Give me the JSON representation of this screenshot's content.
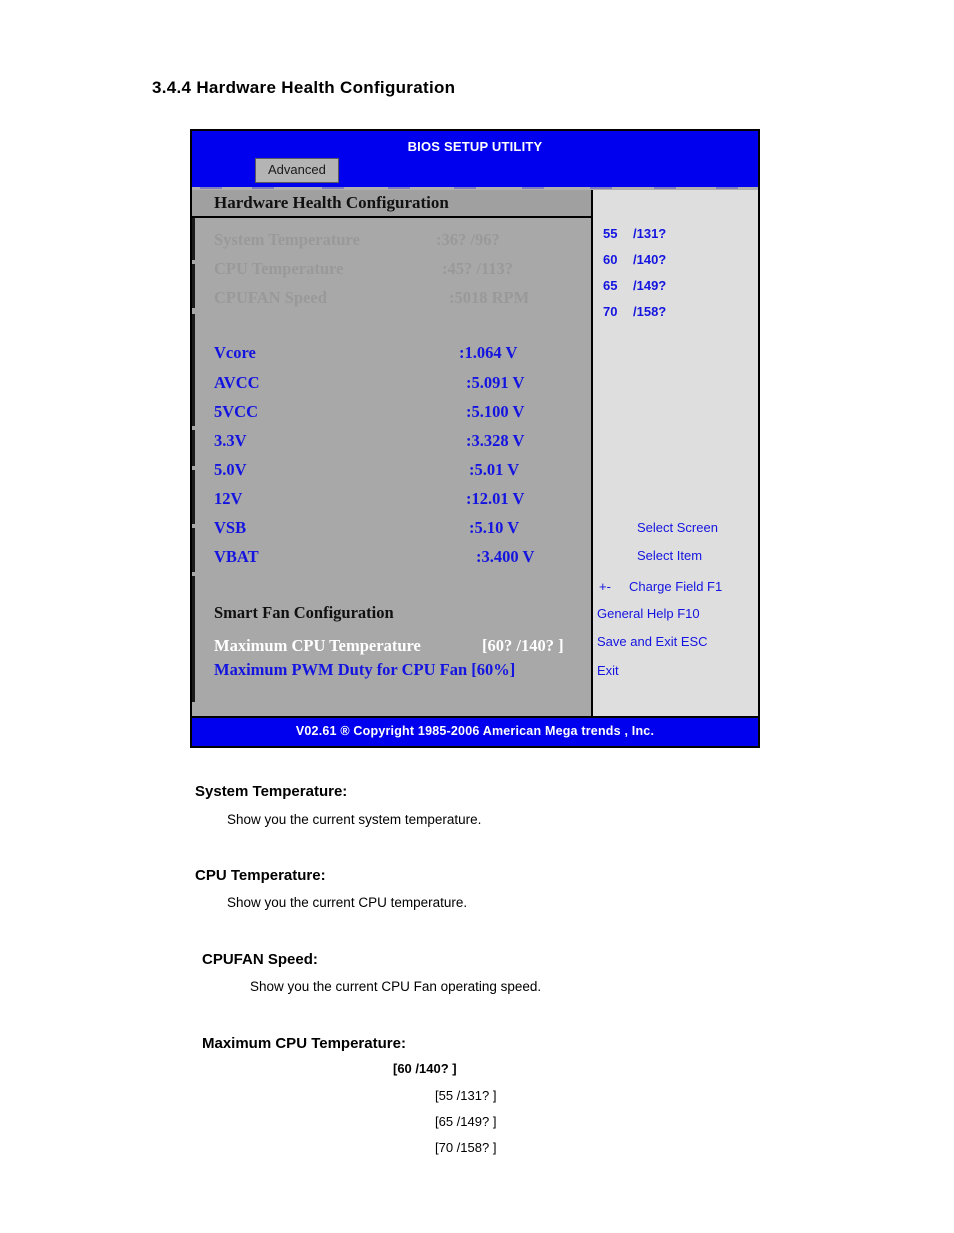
{
  "document": {
    "section_heading": "3.4.4 Hardware Health Configuration"
  },
  "bios": {
    "title": "BIOS SETUP UTILITY",
    "tab": "Advanced",
    "pane_header": "Hardware Health Configuration",
    "footer": "V02.61 ®  Copyright 1985-2006 American Mega trends , Inc.",
    "colors": {
      "title_bar": "#0000ee",
      "main_pane": "#a8a8a8",
      "help_pane": "#dedede",
      "value_blue": "#1414e0",
      "dim_gray": "#999999",
      "highlight_white": "#ffffff"
    },
    "readings": [
      {
        "label": "System Temperature",
        "value": ":36?  /96?",
        "style": "dim"
      },
      {
        "label": "CPU Temperature",
        "value": ":45?  /113?",
        "style": "dim"
      },
      {
        "label": "CPUFAN Speed",
        "value": ":5018 RPM",
        "style": "dim"
      }
    ],
    "voltages": [
      {
        "label": "Vcore",
        "value": ":1.064 V"
      },
      {
        "label": "AVCC",
        "value": ":5.091 V"
      },
      {
        "label": "5VCC",
        "value": ":5.100 V"
      },
      {
        "label": "3.3V",
        "value": ":3.328 V"
      },
      {
        "label": "5.0V",
        "value": ":5.01 V"
      },
      {
        "label": "12V",
        "value": ":12.01 V"
      },
      {
        "label": "VSB",
        "value": ":5.10 V"
      },
      {
        "label": "VBAT",
        "value": ":3.400 V"
      }
    ],
    "smart_fan": {
      "heading": "Smart Fan Configuration",
      "max_cpu_temp_label": "Maximum CPU Temperature",
      "max_cpu_temp_value": "[60?  /140?  ]",
      "max_pwm_label": "Maximum PWM Duty for CPU Fan [60%]"
    },
    "help": {
      "options": [
        {
          "num": "55",
          "deg": "/131?"
        },
        {
          "num": "60",
          "deg": "/140?"
        },
        {
          "num": "65",
          "deg": "/149?"
        },
        {
          "num": "70",
          "deg": "/158?"
        }
      ],
      "keys": [
        "Select Screen",
        "Select Item",
        "Charge Field F1",
        "General Help F10",
        "Save and Exit ESC",
        "Exit"
      ],
      "plus_minus": "+-"
    }
  },
  "descriptions": [
    {
      "heading": "System Temperature:",
      "text": "Show you the current system temperature."
    },
    {
      "heading": "CPU Temperature:",
      "text": "Show you the current CPU temperature."
    },
    {
      "heading": "CPUFAN Speed:",
      "text": "Show you the current CPU Fan operating speed."
    }
  ],
  "max_cpu_temp_section": {
    "heading": "Maximum CPU Temperature:",
    "default_option": "[60   /140?  ]",
    "options": [
      "[55   /131?  ]",
      "[65   /149?  ]",
      "[70   /158?  ]"
    ]
  }
}
